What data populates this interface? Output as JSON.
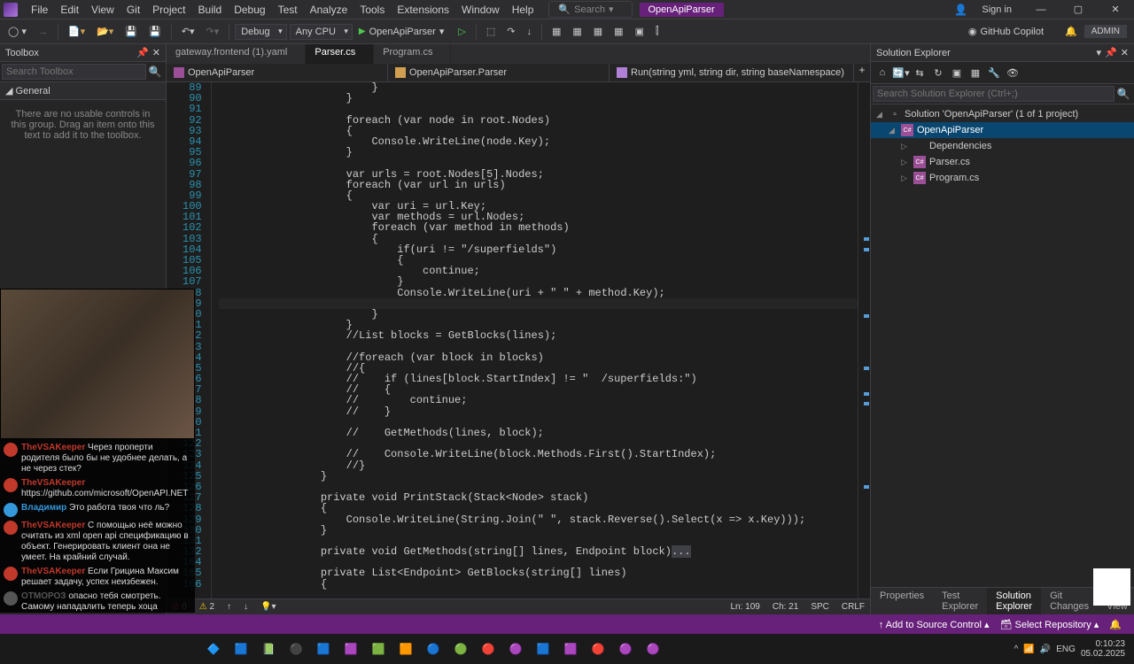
{
  "menu": [
    "File",
    "Edit",
    "View",
    "Git",
    "Project",
    "Build",
    "Debug",
    "Test",
    "Analyze",
    "Tools",
    "Extensions",
    "Window",
    "Help"
  ],
  "search_placeholder": "Search",
  "brand": "OpenApiParser",
  "signin": "Sign in",
  "toolbar": {
    "config": "Debug",
    "platform": "Any CPU",
    "start_target": "OpenApiParser",
    "copilot": "GitHub Copilot",
    "admin": "ADMIN"
  },
  "toolbox": {
    "title": "Toolbox",
    "search": "Search Toolbox",
    "group": "General",
    "empty": "There are no usable controls in this group. Drag an item onto this text to add it to the toolbox."
  },
  "tabs": [
    {
      "label": "gateway.frontend (1).yaml",
      "active": false
    },
    {
      "label": "Parser.cs",
      "active": true
    },
    {
      "label": "Program.cs",
      "active": false
    }
  ],
  "nav": {
    "project": "OpenApiParser",
    "type": "OpenApiParser.Parser",
    "member": "Run(string yml, string dir, string baseNamespace)"
  },
  "code_start": 89,
  "code_lines": [
    "                        }",
    "                    }",
    "",
    "                    <kw>foreach</kw> (<kw>var</kw> node <kw>in</kw> root.Nodes)",
    "                    {",
    "                        <type>Console</type>.<mth>WriteLine</mth>(node.Key);",
    "                    }",
    "",
    "                    <kw>var</kw> urls = root.Nodes[<num>5</num>].Nodes;",
    "                    <kw>foreach</kw> (<kw>var</kw> url <kw>in</kw> urls)",
    "                    {",
    "                        <kw>var</kw> uri = url.Key;",
    "                        <kw>var</kw> methods = url.Nodes;",
    "                        <kw>foreach</kw> (<kw>var</kw> method <kw>in</kw> methods)",
    "                        {",
    "                            <kw>if</kw>(uri != <str>\"/superfields\"</str>)",
    "                            {",
    "                                <kw>continue</kw>;",
    "                            }",
    "                            <type>Console</type>.<mth>WriteLine</mth>(uri + <str>\" \"</str> + method.Key);",
    "                            ",
    "                        }",
    "                    }",
    "                    <cm>//List<Endpoint> blocks = GetBlocks(lines);</cm>",
    "",
    "                    <cm>//foreach (var block in blocks)</cm>",
    "                    <cm>//{</cm>",
    "                    <cm>//    if (lines[block.StartIndex] != \"  /superfields:\")</cm>",
    "                    <cm>//    {</cm>",
    "                    <cm>//        continue;</cm>",
    "                    <cm>//    }</cm>",
    "",
    "                    <cm>//    GetMethods(lines, block);</cm>",
    "",
    "                    <cm>//    Console.WriteLine(block.Methods.First().StartIndex);</cm>",
    "                    <cm>//}</cm>",
    "                }",
    "",
    "                <kw>private</kw> <kw>void</kw> <mth>PrintStack</mth>(<type>Stack</type><<type>Node</type>> stack)",
    "                {",
    "                    <type>Console</type>.<mth>WriteLine</mth>(<type>String</type>.<mth>Join</mth>(<str>\" \"</str>, stack.<mth>Reverse</mth>().<mth>Select</mth>(x => x.Key)));",
    "                }",
    "",
    "                <kw>private</kw> <kw>void</kw> <mth>GetMethods</mth>(<kw>string</kw>[] lines, <type>Endpoint</type> block)<span style='background:#3f3f46'>...</span>",
    "",
    "                <kw>private</kw> <type>List</type><<type>Endpoint</type>> <mth>GetBlocks</mth>(<kw>string</kw>[] lines)",
    "                {"
  ],
  "line_numbers": [
    "89",
    "90",
    "91",
    "92",
    "93",
    "94",
    "95",
    "96",
    "97",
    "98",
    "99",
    "100",
    "101",
    "102",
    "103",
    "104",
    "105",
    "106",
    "107",
    "108",
    "109",
    "110",
    "111",
    "112",
    "113",
    "114",
    "115",
    "116",
    "117",
    "118",
    "119",
    "120",
    "121",
    "122",
    "123",
    "124",
    "125",
    "126",
    "127",
    "128",
    "129",
    "130",
    "131",
    "132",
    "164",
    "165",
    "166"
  ],
  "editor_footer": {
    "errors": "0",
    "warnings": "2",
    "ln": "Ln: 109",
    "ch": "Ch: 21",
    "spc": "SPC",
    "crlf": "CRLF"
  },
  "solution_explorer": {
    "title": "Solution Explorer",
    "search": "Search Solution Explorer (Ctrl+;)",
    "root": "Solution 'OpenApiParser' (1 of 1 project)",
    "items": [
      {
        "label": "OpenApiParser",
        "indent": 1,
        "icon": "C#",
        "selected": true,
        "exp": "◢"
      },
      {
        "label": "Dependencies",
        "indent": 2,
        "icon": "▫",
        "exp": "▷"
      },
      {
        "label": "Parser.cs",
        "indent": 2,
        "icon": "C#",
        "exp": "▷"
      },
      {
        "label": "Program.cs",
        "indent": 2,
        "icon": "C#",
        "exp": "▷"
      }
    ]
  },
  "bottom_tabs": [
    "Properties",
    "Test Explorer",
    "Solution Explorer",
    "Git Changes",
    "Class View"
  ],
  "bottom_active": 2,
  "statusbar": {
    "source_control": "Add to Source Control",
    "repo": "Select Repository"
  },
  "tray": {
    "lang": "ENG",
    "time": "0:10:23",
    "date": "05.02.2025"
  },
  "chat": [
    {
      "user": "TheVSAKeeper",
      "color": "#c0392b",
      "msg": "Через проперти родителя было бы не удобнее делать, а не через стек?",
      "avatar": "#c0392b"
    },
    {
      "user": "TheVSAKeeper",
      "color": "#c0392b",
      "msg": "https://github.com/microsoft/OpenAPI.NET",
      "avatar": "#c0392b"
    },
    {
      "user": "Владимир",
      "color": "#3498db",
      "msg": "Это работа твоя что ль?",
      "avatar": "#3498db"
    },
    {
      "user": "TheVSAKeeper",
      "color": "#c0392b",
      "msg": "С помощью неё можно считать из xml open api спецификацию в объект. Генерировать клиент она не умеет. На крайний случай.",
      "avatar": "#c0392b"
    },
    {
      "user": "TheVSAKeeper",
      "color": "#c0392b",
      "msg": "Если Грицина Максим решает задачу, успех неизбежен.",
      "avatar": "#c0392b"
    },
    {
      "user": "ОТМОРОЗ",
      "color": "#555",
      "msg": "опасно тебя смотреть. Самому нападалить теперь хоца",
      "avatar": "#555"
    }
  ]
}
